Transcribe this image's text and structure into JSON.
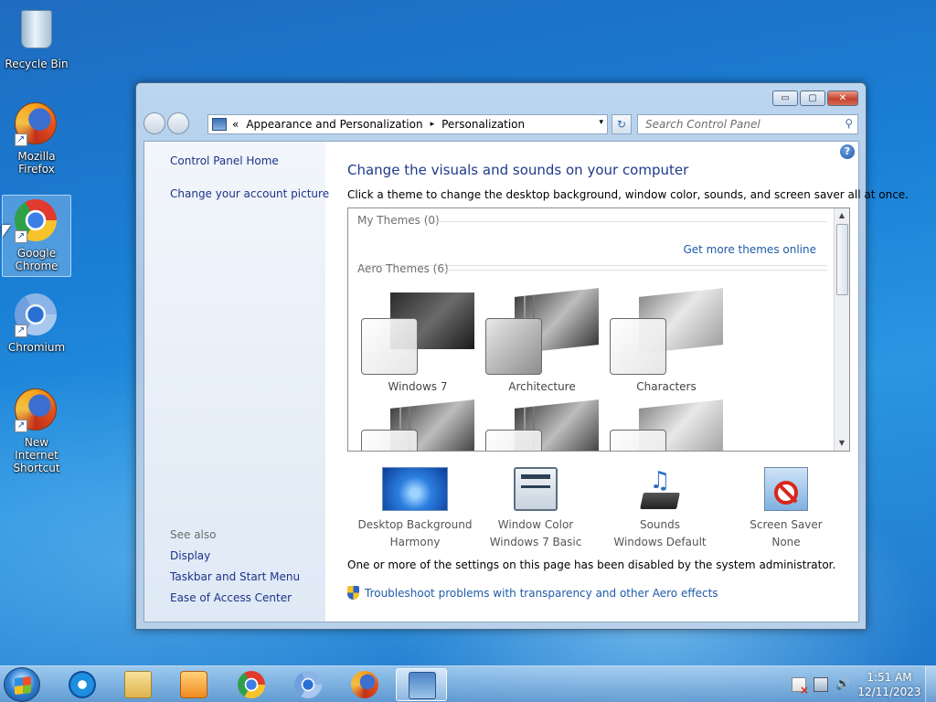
{
  "desktop": {
    "icons": [
      {
        "label_1": "Recycle Bin",
        "label_2": "",
        "icon": "recycle-bin-icon"
      },
      {
        "label_1": "Mozilla",
        "label_2": "Firefox",
        "icon": "firefox-icon"
      },
      {
        "label_1": "Google",
        "label_2": "Chrome",
        "icon": "chrome-icon"
      },
      {
        "label_1": "Chromium",
        "label_2": "",
        "icon": "chromium-icon"
      },
      {
        "label_1": "New Internet",
        "label_2": "Shortcut",
        "icon": "firefox-icon"
      }
    ]
  },
  "window": {
    "controls": {
      "minimize": "▭",
      "maximize": "▢",
      "close": "✕"
    },
    "address": {
      "prefix": "«",
      "crumb_1": "Appearance and Personalization",
      "separator": "▸",
      "crumb_2": "Personalization",
      "dropdown": "▾"
    },
    "refresh_symbol": "↻",
    "search_placeholder": "Search Control Panel",
    "search_icon_glyph": "⚲",
    "help_glyph": "?",
    "left_pane": {
      "links": [
        "Control Panel Home",
        "Change your account picture"
      ],
      "see_also_label": "See also",
      "see_also": [
        "Display",
        "Taskbar and Start Menu",
        "Ease of Access Center"
      ]
    },
    "main": {
      "heading": "Change the visuals and sounds on your computer",
      "subtext": "Click a theme to change the desktop background, window color, sounds, and screen saver all at once.",
      "my_themes_label": "My Themes (0)",
      "get_more_link": "Get more themes online",
      "aero_themes_label": "Aero Themes (6)",
      "themes": [
        "Windows 7",
        "Architecture",
        "Characters"
      ],
      "tiles": [
        {
          "title": "Desktop Background",
          "value": "Harmony"
        },
        {
          "title": "Window Color",
          "value": "Windows 7 Basic"
        },
        {
          "title": "Sounds",
          "value": "Windows Default"
        },
        {
          "title": "Screen Saver",
          "value": "None"
        }
      ],
      "disabled_note": "One or more of the settings on this page has been disabled by the system administrator.",
      "troubleshoot_link": "Troubleshoot problems with transparency and other Aero effects"
    }
  },
  "taskbar": {
    "pinned": [
      "internet-explorer-icon",
      "windows-explorer-icon",
      "media-player-icon",
      "chrome-icon",
      "chromium-icon",
      "firefox-icon",
      "control-panel-icon"
    ],
    "clock": {
      "time": "1:51 AM",
      "date": "12/11/2023"
    },
    "volume_glyph": "🔊"
  }
}
